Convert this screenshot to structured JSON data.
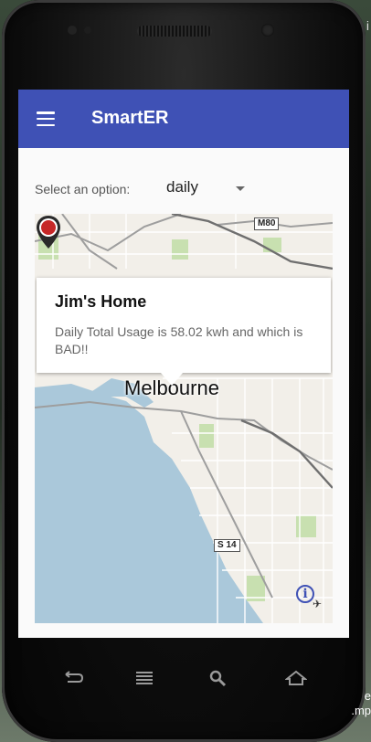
{
  "app": {
    "title": "SmartER"
  },
  "selector": {
    "label": "Select an option:",
    "value": "daily"
  },
  "map": {
    "city_label": "Melbourne",
    "road_labels": [
      "M80",
      "S 14"
    ],
    "info_window": {
      "title": "Jim's Home",
      "text": "Daily Total Usage is 58.02 kwh and which is BAD!!"
    },
    "marker_color": "#c62828"
  },
  "colors": {
    "appbar": "#3f51b5",
    "water": "#aac8da",
    "park": "#c8e0b0"
  },
  "edge_text": {
    "top_right": "i",
    "bottom_right_1": "e",
    "bottom_right_2": ".mp"
  },
  "nav_icons": [
    "back-icon",
    "menu-icon",
    "search-icon",
    "home-icon"
  ]
}
